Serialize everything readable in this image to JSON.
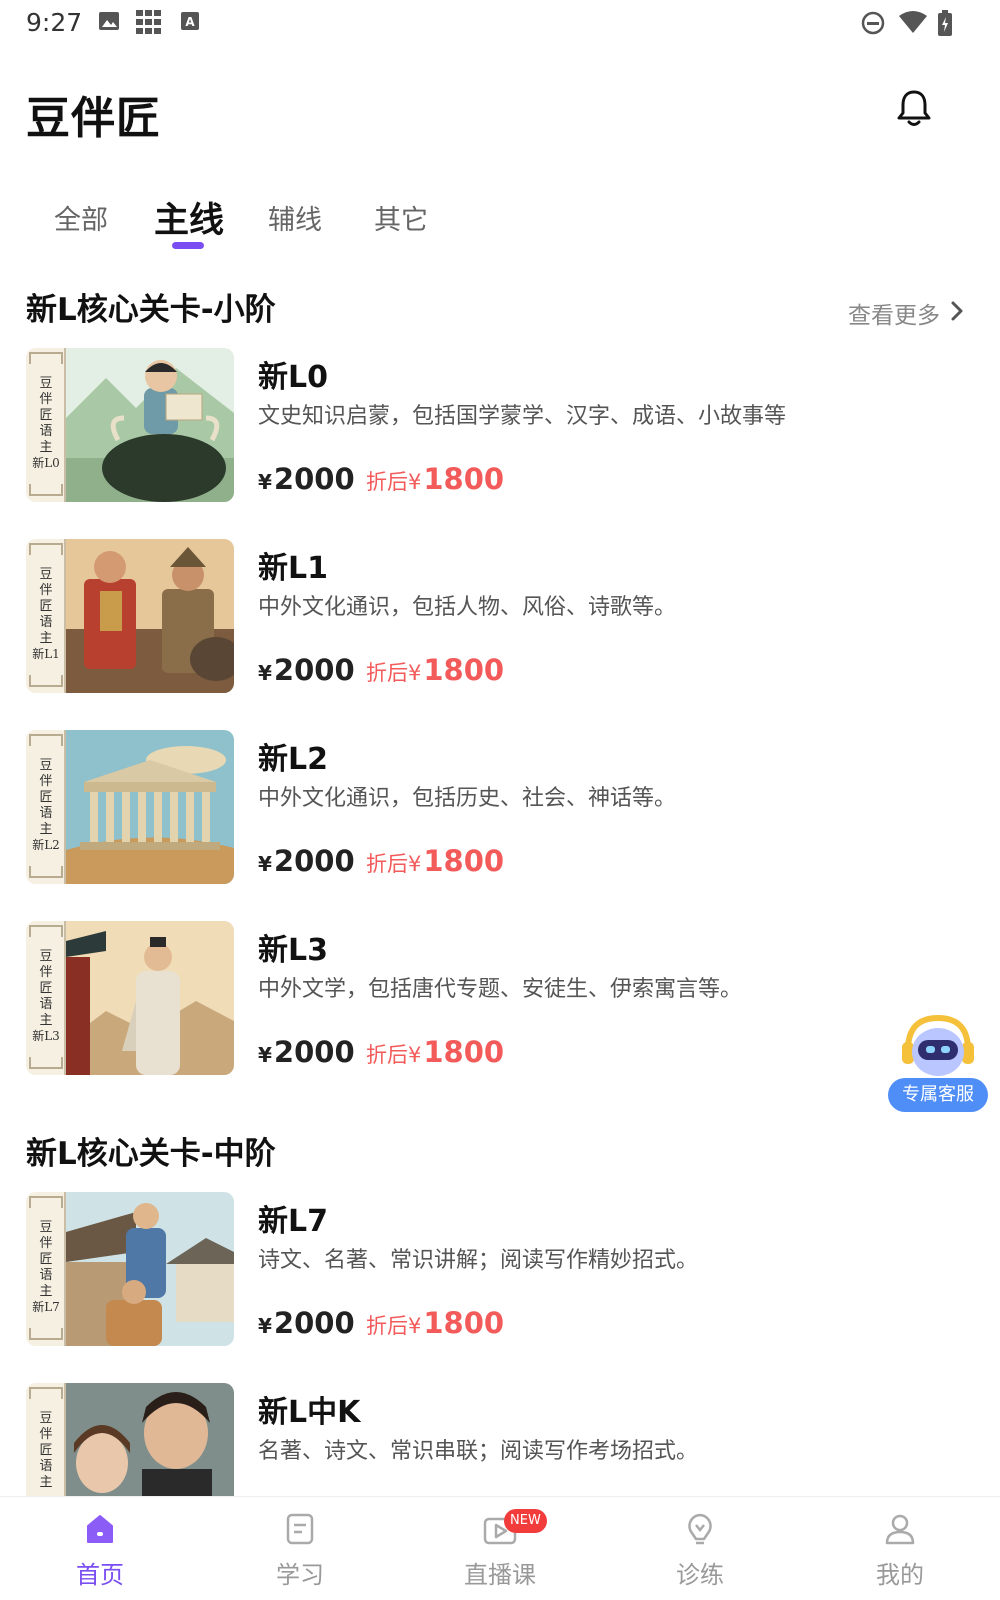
{
  "status_bar": {
    "time": "9:27"
  },
  "app": {
    "title": "豆伴匠"
  },
  "tabs": [
    {
      "label": "全部",
      "active": false
    },
    {
      "label": "主线",
      "active": true
    },
    {
      "label": "辅线",
      "active": false
    },
    {
      "label": "其它",
      "active": false
    }
  ],
  "sections": [
    {
      "title": "新L核心关卡-小阶",
      "see_more": "查看更多",
      "courses": [
        {
          "thumb_level": "新L0",
          "name": "新L0",
          "desc": "文史知识启蒙，包括国学蒙学、汉字、成语、小故事等",
          "currency": "¥",
          "price": "2000",
          "discount_label": "折后¥",
          "discount_price": "1800"
        },
        {
          "thumb_level": "新L1",
          "name": "新L1",
          "desc": "中外文化通识，包括人物、风俗、诗歌等。",
          "currency": "¥",
          "price": "2000",
          "discount_label": "折后¥",
          "discount_price": "1800"
        },
        {
          "thumb_level": "新L2",
          "name": "新L2",
          "desc": "中外文化通识，包括历史、社会、神话等。",
          "currency": "¥",
          "price": "2000",
          "discount_label": "折后¥",
          "discount_price": "1800"
        },
        {
          "thumb_level": "新L3",
          "name": "新L3",
          "desc": "中外文学，包括唐代专题、安徒生、伊索寓言等。",
          "currency": "¥",
          "price": "2000",
          "discount_label": "折后¥",
          "discount_price": "1800"
        }
      ]
    },
    {
      "title": "新L核心关卡-中阶",
      "courses": [
        {
          "thumb_level": "新L7",
          "name": "新L7",
          "desc": "诗文、名著、常识讲解；阅读写作精妙招式。",
          "currency": "¥",
          "price": "2000",
          "discount_label": "折后¥",
          "discount_price": "1800"
        },
        {
          "thumb_level": "",
          "name": "新L中K",
          "desc": "名著、诗文、常识串联；阅读写作考场招式。"
        }
      ]
    }
  ],
  "thumb_series": "豆伴匠语主",
  "customer_service": {
    "label": "专属客服"
  },
  "bottom_nav": [
    {
      "label": "首页",
      "icon": "home-icon",
      "active": true
    },
    {
      "label": "学习",
      "icon": "study-icon",
      "active": false
    },
    {
      "label": "直播课",
      "icon": "live-icon",
      "active": false,
      "badge": "NEW"
    },
    {
      "label": "诊练",
      "icon": "diagnose-icon",
      "active": false
    },
    {
      "label": "我的",
      "icon": "profile-icon",
      "active": false
    }
  ],
  "colors": {
    "accent": "#7b4ef3",
    "discount": "#f35a5a",
    "service": "#4f8ef7"
  }
}
